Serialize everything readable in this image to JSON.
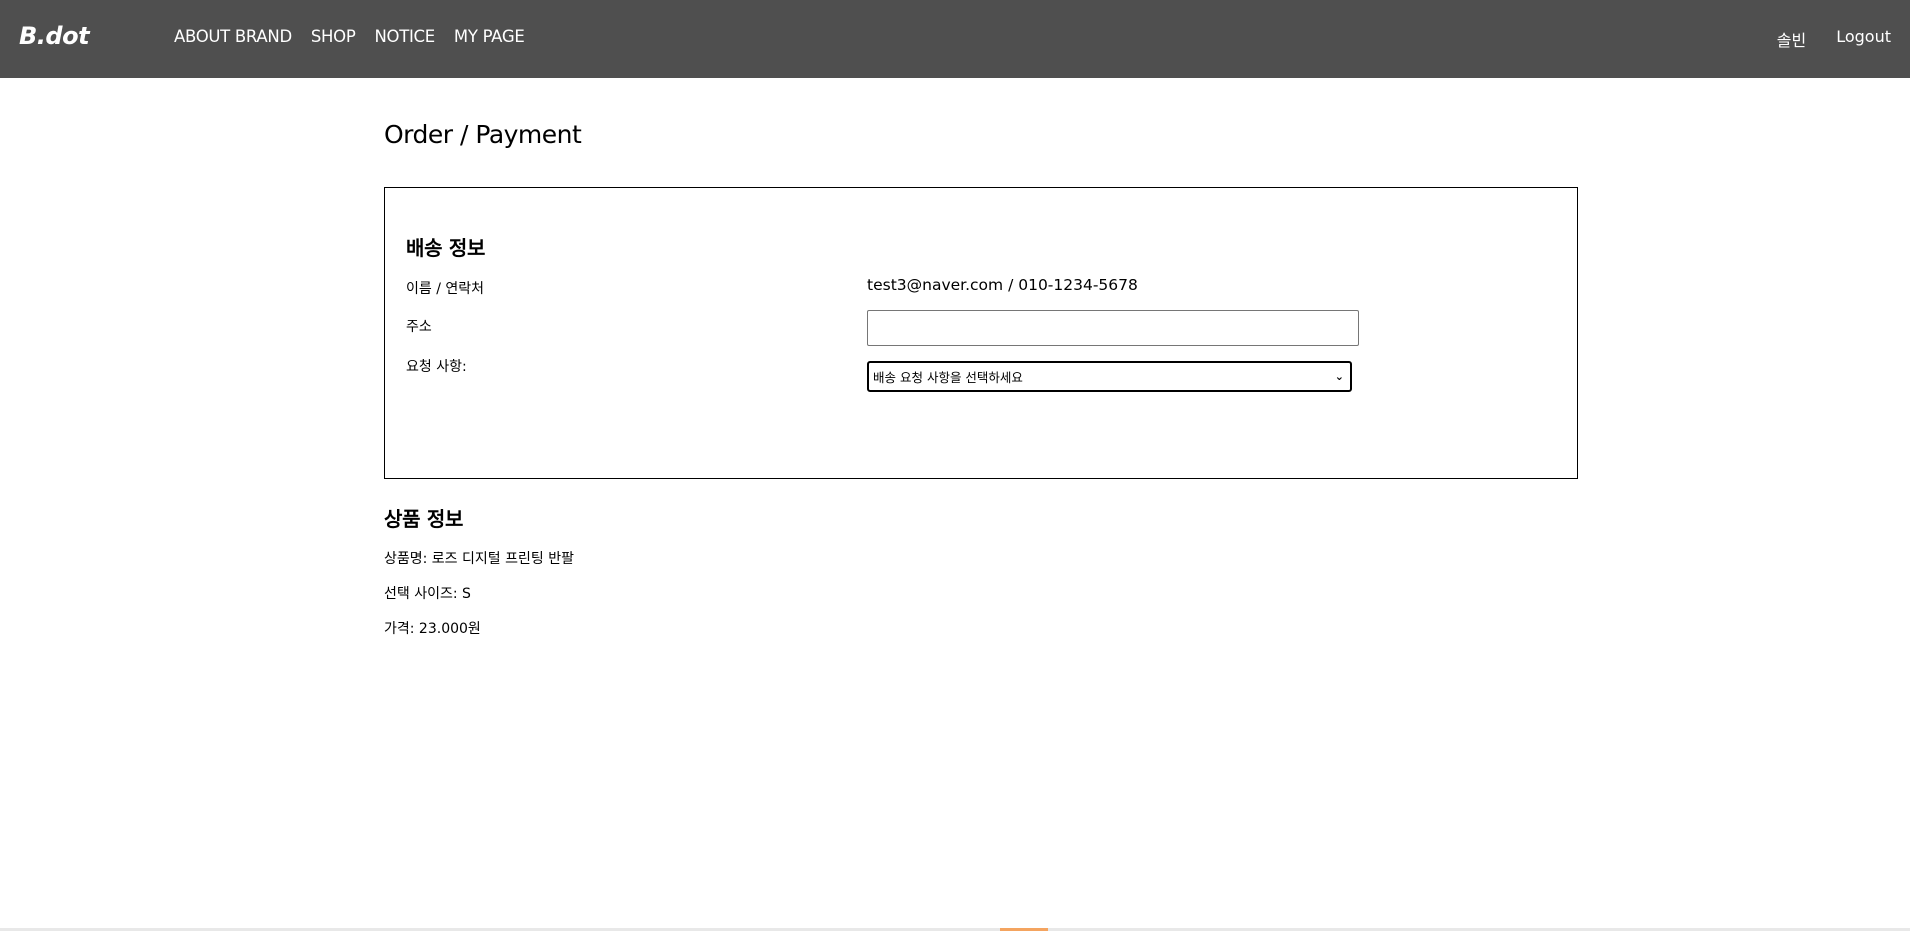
{
  "header": {
    "logo": "B.dot",
    "nav": [
      "ABOUT BRAND",
      "SHOP",
      "NOTICE",
      "MY PAGE"
    ],
    "user_name": "솔빈",
    "logout_label": "Logout"
  },
  "page": {
    "title": "Order / Payment"
  },
  "shipping": {
    "heading": "배송 정보",
    "name_contact_label": "이름 / 연락처",
    "name_contact_value": "test3@naver.com / 010-1234-5678",
    "address_label": "주소",
    "address_value": "",
    "request_label": "요청 사항:",
    "request_selected": "배송 요청 사항을 선택하세요"
  },
  "product": {
    "heading": "상품 정보",
    "name_line": "상품명: 로즈 디지털 프린팅 반팔",
    "size_line": "선택 사이즈: S",
    "price_line": "가격: 23.000원"
  },
  "colors": {
    "header_bg": "#4f4f4f",
    "accent": "#f4a460"
  }
}
